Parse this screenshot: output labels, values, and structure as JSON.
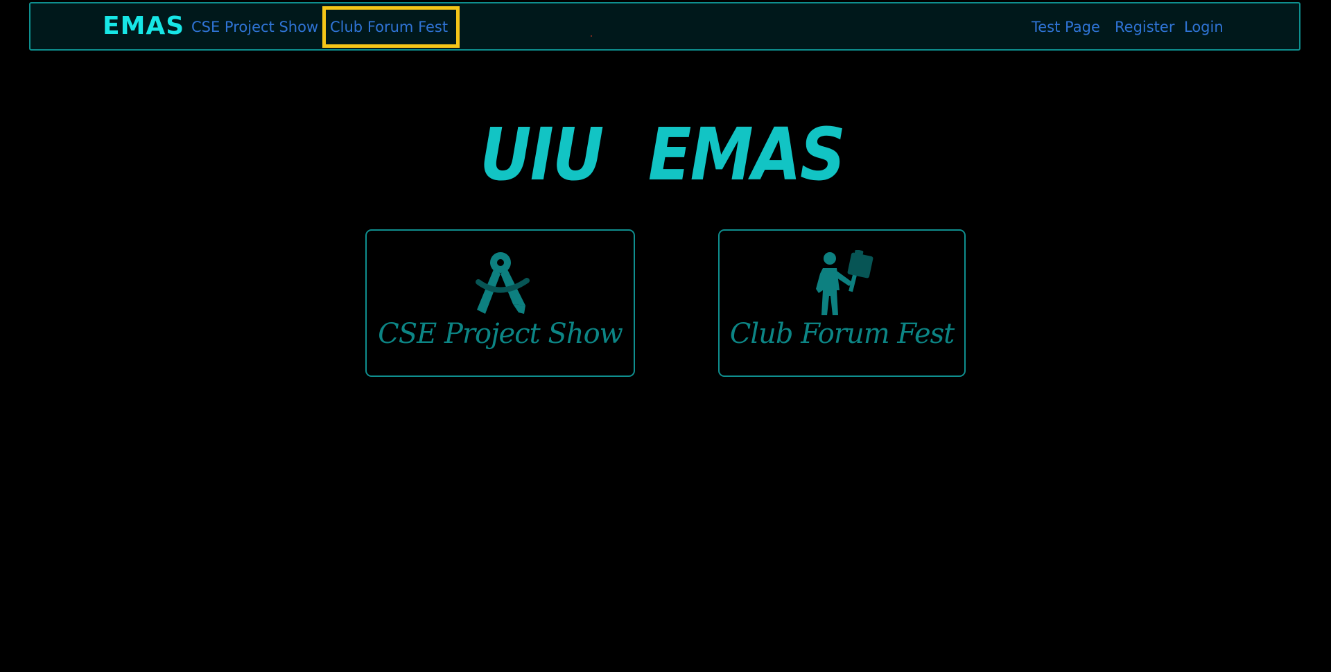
{
  "navbar": {
    "brand": "EMAS",
    "links_left": [
      {
        "label": "CSE Project Show"
      },
      {
        "label": "Club Forum Fest"
      }
    ],
    "links_right": [
      {
        "label": "Test Page"
      },
      {
        "label": "Register"
      },
      {
        "label": "Login"
      }
    ]
  },
  "hero": {
    "title": "UIU EMAS"
  },
  "cards": [
    {
      "label": "CSE Project Show",
      "icon": "compass-drafting-icon"
    },
    {
      "label": "Club Forum Fest",
      "icon": "person-sign-icon"
    }
  ],
  "colors": {
    "background": "#000000",
    "navbar_bg": "#00181b",
    "accent_teal": "#12c4c4",
    "brand_cyan": "#17e6e6",
    "link_blue": "#2f74d6",
    "card_teal": "#0c8585",
    "highlight_yellow": "#f5c518"
  }
}
